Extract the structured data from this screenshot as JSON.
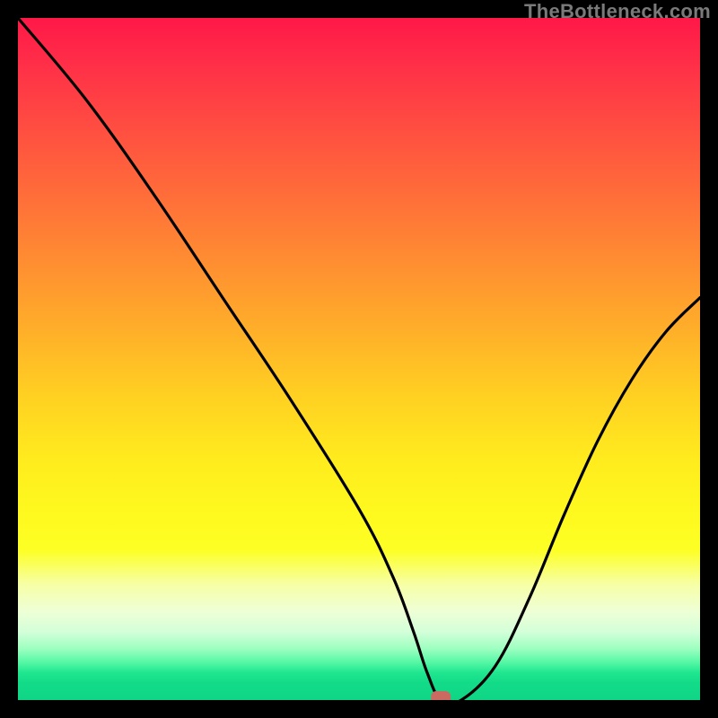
{
  "watermark": "TheBottleneck.com",
  "chart_data": {
    "type": "line",
    "title": "",
    "xlabel": "",
    "ylabel": "",
    "xlim": [
      0,
      100
    ],
    "ylim": [
      0,
      100
    ],
    "grid": false,
    "series": [
      {
        "name": "bottleneck-curve",
        "x": [
          0,
          10,
          20,
          30,
          40,
          50,
          55,
          58,
          60,
          62,
          65,
          70,
          75,
          80,
          85,
          90,
          95,
          100
        ],
        "values": [
          100,
          88,
          74,
          59,
          44,
          28,
          18,
          10,
          4,
          0,
          0,
          5,
          15,
          27,
          38,
          47,
          54,
          59
        ]
      }
    ],
    "marker": {
      "name": "optimal-point",
      "x": 62,
      "y": 0,
      "color": "#cb6a60"
    },
    "background_gradient": {
      "orientation": "vertical",
      "stops": [
        {
          "pos": 0.0,
          "color": "#ff1848"
        },
        {
          "pos": 0.25,
          "color": "#ff6a3a"
        },
        {
          "pos": 0.55,
          "color": "#ffcf22"
        },
        {
          "pos": 0.8,
          "color": "#fdff24"
        },
        {
          "pos": 0.9,
          "color": "#d3ffd9"
        },
        {
          "pos": 1.0,
          "color": "#0fd686"
        }
      ]
    }
  }
}
